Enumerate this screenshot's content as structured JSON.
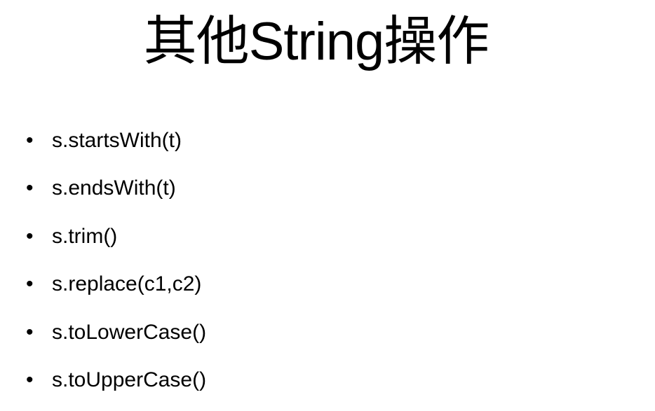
{
  "slide": {
    "title": "其他String操作",
    "bullet_symbol": "•",
    "items": [
      "s.startsWith(t)",
      "s.endsWith(t)",
      "s.trim()",
      "s.replace(c1,c2)",
      "s.toLowerCase()",
      "s.toUpperCase()"
    ]
  }
}
